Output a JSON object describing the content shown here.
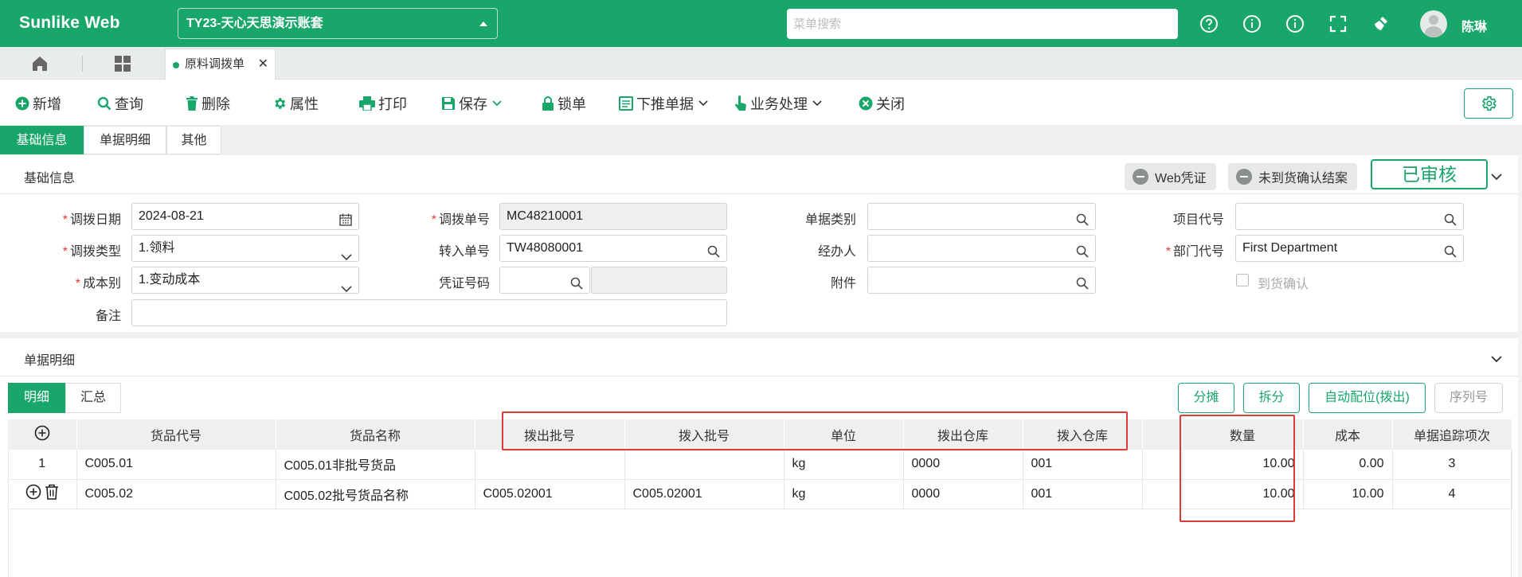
{
  "app": {
    "brand": "Sunlike Web",
    "account": "TY23-天心天思演示账套",
    "search_placeholder": "菜单搜索",
    "user": "陈琳"
  },
  "tabs": {
    "open_tab": "原料调拨单"
  },
  "toolbar": {
    "new": "新增",
    "query": "查询",
    "delete": "删除",
    "properties": "属性",
    "print": "打印",
    "save": "保存",
    "lock": "锁单",
    "push_down": "下推单据",
    "business": "业务处理",
    "close": "关闭"
  },
  "section_tabs": [
    "基础信息",
    "单据明细",
    "其他"
  ],
  "basic": {
    "title": "基础信息",
    "web_voucher": "Web凭证",
    "unreceived_close": "未到货确认结案",
    "status": "已审核",
    "fields": {
      "transfer_date": {
        "label": "调拨日期",
        "value": "2024-08-21"
      },
      "transfer_no": {
        "label": "调拨单号",
        "value": "MC48210001"
      },
      "doc_category": {
        "label": "单据类别",
        "value": ""
      },
      "project_code": {
        "label": "项目代号",
        "value": ""
      },
      "transfer_type": {
        "label": "调拨类型",
        "value": "1.领料"
      },
      "in_doc_no": {
        "label": "转入单号",
        "value": "TW48080001"
      },
      "handler": {
        "label": "经办人",
        "value": ""
      },
      "dept_code": {
        "label": "部门代号",
        "value": "First Department"
      },
      "cost_type": {
        "label": "成本别",
        "value": "1.变动成本"
      },
      "voucher_no": {
        "label": "凭证号码",
        "value": ""
      },
      "attachment": {
        "label": "附件",
        "value": ""
      },
      "arrival_confirm": {
        "label": "到货确认",
        "checked": false
      },
      "remark": {
        "label": "备注",
        "value": ""
      }
    }
  },
  "detail": {
    "title": "单据明细",
    "sub_tabs": [
      "明细",
      "汇总"
    ],
    "buttons": {
      "allocate": "分摊",
      "split": "拆分",
      "auto_assign": "自动配位(拨出)",
      "serial": "序列号"
    },
    "columns": [
      "货品代号",
      "货品名称",
      "拨出批号",
      "拨入批号",
      "单位",
      "拨出仓库",
      "拨入仓库",
      "",
      "数量",
      "成本",
      "单据追踪项次"
    ],
    "rows": [
      {
        "index": "1",
        "code": "C005.01",
        "name": "C005.01非批号货品",
        "out_batch": "",
        "in_batch": "",
        "unit": "kg",
        "out_wh": "0000",
        "in_wh": "001",
        "extra": "",
        "qty": "10.00",
        "cost": "0.00",
        "trace": "3"
      },
      {
        "index": "",
        "code": "C005.02",
        "name": "C005.02批号货品名称",
        "out_batch": "C005.02001",
        "in_batch": "C005.02001",
        "unit": "kg",
        "out_wh": "0000",
        "in_wh": "001",
        "extra": "",
        "qty": "10.00",
        "cost": "10.00",
        "trace": "4"
      }
    ]
  },
  "colors": {
    "brand": "#18a66a",
    "highlight": "#e03a3a"
  }
}
